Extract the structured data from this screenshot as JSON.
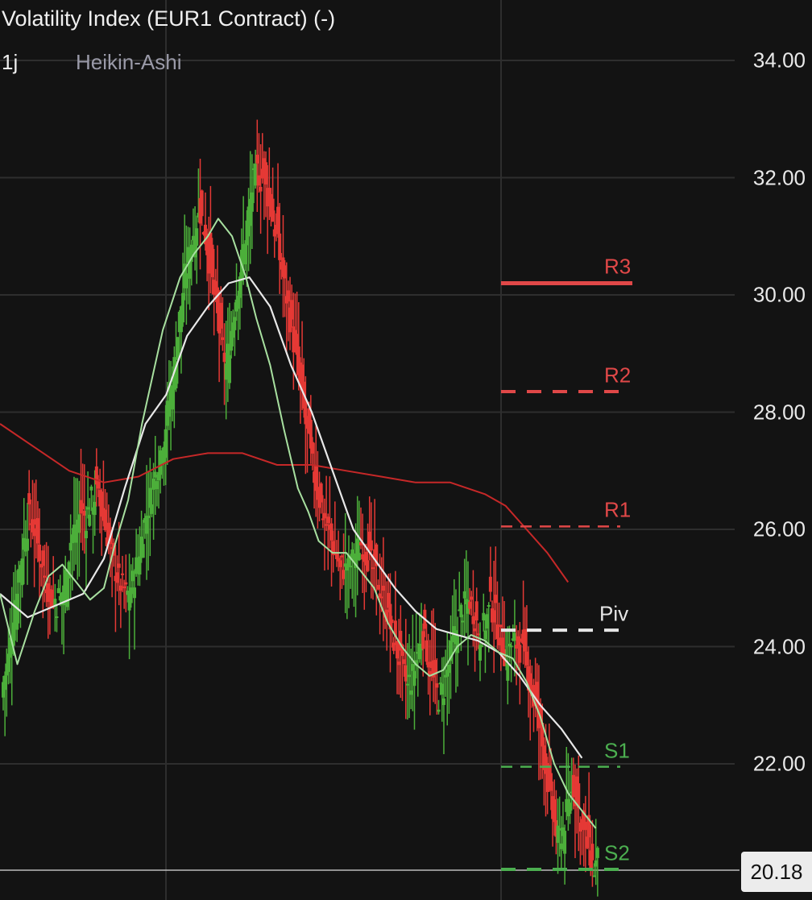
{
  "header": {
    "title": "Volatility Index (EUR1 Contract) (-)",
    "interval": "1j",
    "chart_type_label": "Heikin-Ashi"
  },
  "price": {
    "last": "20.18",
    "last_value": 20.18
  },
  "colors": {
    "background": "#131313",
    "grid": "#2e2e2e",
    "up": "#4caf3a",
    "down": "#e53935",
    "ma_long": "#c62828",
    "ma_mid": "#e8e8e8",
    "ma_short": "#a8e0a0",
    "resistance": "#e04848",
    "support": "#4caf50",
    "pivot": "#e6e6e6"
  },
  "y_axis": {
    "ticks": [
      {
        "value": 34,
        "label": "34.00"
      },
      {
        "value": 32,
        "label": "32.00"
      },
      {
        "value": 30,
        "label": "30.00"
      },
      {
        "value": 28,
        "label": "28.00"
      },
      {
        "value": 26,
        "label": "26.00"
      },
      {
        "value": 24,
        "label": "24.00"
      },
      {
        "value": 22,
        "label": "22.00"
      }
    ]
  },
  "pivots": [
    {
      "label": "R3",
      "value": 30.2,
      "kind": "resistance",
      "style": "solid"
    },
    {
      "label": "R2",
      "value": 28.35,
      "kind": "resistance",
      "style": "dashed"
    },
    {
      "label": "R1",
      "value": 26.05,
      "kind": "resistance",
      "style": "dashed-thin"
    },
    {
      "label": "Piv",
      "value": 24.28,
      "kind": "pivot",
      "style": "dashed"
    },
    {
      "label": "S1",
      "value": 21.95,
      "kind": "support",
      "style": "dashed-thin"
    },
    {
      "label": "S2",
      "value": 20.2,
      "kind": "support",
      "style": "dashed"
    }
  ],
  "chart_data": {
    "type": "line",
    "candles": "heikin-ashi",
    "ylim": [
      19.6,
      35.0
    ],
    "close_series": [
      23.4,
      23.8,
      24.6,
      25.3,
      25.8,
      26.2,
      26.0,
      25.6,
      25.2,
      24.9,
      24.7,
      24.8,
      25.2,
      25.8,
      26.1,
      26.3,
      26.2,
      26.5,
      26.6,
      26.3,
      25.9,
      25.5,
      25.2,
      25.0,
      24.9,
      25.1,
      25.5,
      26.0,
      26.4,
      26.8,
      27.2,
      27.6,
      28.2,
      28.8,
      29.6,
      30.3,
      30.8,
      31.2,
      31.4,
      31.0,
      30.4,
      29.8,
      29.2,
      28.8,
      29.4,
      30.0,
      30.6,
      31.2,
      31.8,
      32.1,
      32.0,
      31.7,
      31.3,
      30.8,
      30.3,
      29.8,
      29.2,
      28.6,
      28.0,
      27.4,
      26.9,
      26.5,
      26.2,
      25.9,
      25.6,
      25.4,
      25.3,
      25.4,
      25.6,
      25.8,
      25.6,
      25.4,
      25.2,
      24.9,
      24.6,
      24.2,
      23.9,
      23.6,
      23.3,
      23.5,
      23.9,
      24.2,
      23.8,
      23.4,
      23.1,
      23.3,
      23.7,
      24.2,
      24.5,
      24.7,
      24.8,
      24.5,
      24.2,
      24.4,
      24.7,
      24.5,
      24.1,
      23.8,
      24.0,
      24.1,
      23.9,
      23.6,
      23.2,
      22.8,
      22.3,
      21.7,
      21.1,
      20.7,
      20.9,
      21.3,
      21.6,
      21.2,
      20.8,
      20.5,
      20.18
    ],
    "ma_short": [
      [
        0,
        24.9
      ],
      [
        5,
        23.7
      ],
      [
        10,
        24.6
      ],
      [
        14,
        25.2
      ],
      [
        18,
        25.4
      ],
      [
        22,
        25.1
      ],
      [
        26,
        24.8
      ],
      [
        30,
        25.0
      ],
      [
        33,
        25.7
      ],
      [
        37,
        26.5
      ],
      [
        41,
        27.8
      ],
      [
        44,
        28.6
      ],
      [
        47,
        29.4
      ],
      [
        52,
        30.3
      ],
      [
        56,
        30.7
      ],
      [
        60,
        31.0
      ],
      [
        63,
        31.3
      ],
      [
        67,
        31.0
      ],
      [
        71,
        30.3
      ],
      [
        74,
        29.6
      ],
      [
        78,
        28.8
      ],
      [
        82,
        27.7
      ],
      [
        86,
        26.7
      ],
      [
        89,
        26.3
      ],
      [
        92,
        25.8
      ],
      [
        96,
        25.6
      ],
      [
        100,
        25.6
      ],
      [
        104,
        25.3
      ],
      [
        108,
        25.0
      ],
      [
        112,
        24.4
      ],
      [
        116,
        24.0
      ],
      [
        120,
        23.7
      ],
      [
        124,
        23.5
      ],
      [
        128,
        23.6
      ],
      [
        132,
        24.0
      ],
      [
        136,
        24.2
      ],
      [
        140,
        24.1
      ],
      [
        144,
        23.9
      ],
      [
        148,
        23.8
      ],
      [
        152,
        23.4
      ],
      [
        156,
        22.8
      ],
      [
        160,
        22.0
      ],
      [
        164,
        21.5
      ],
      [
        168,
        21.2
      ],
      [
        172,
        20.9
      ]
    ],
    "ma_mid": [
      [
        0,
        24.9
      ],
      [
        8,
        24.5
      ],
      [
        16,
        24.7
      ],
      [
        24,
        24.9
      ],
      [
        30,
        25.5
      ],
      [
        36,
        26.7
      ],
      [
        42,
        27.8
      ],
      [
        48,
        28.3
      ],
      [
        54,
        29.3
      ],
      [
        60,
        29.8
      ],
      [
        66,
        30.2
      ],
      [
        72,
        30.3
      ],
      [
        78,
        29.8
      ],
      [
        84,
        28.8
      ],
      [
        90,
        28.0
      ],
      [
        96,
        27.0
      ],
      [
        102,
        26.0
      ],
      [
        108,
        25.5
      ],
      [
        114,
        25.0
      ],
      [
        120,
        24.6
      ],
      [
        126,
        24.3
      ],
      [
        132,
        24.2
      ],
      [
        138,
        24.1
      ],
      [
        144,
        23.9
      ],
      [
        150,
        23.5
      ],
      [
        156,
        23.0
      ],
      [
        162,
        22.6
      ],
      [
        168,
        22.1
      ]
    ],
    "ma_long": [
      [
        0,
        27.8
      ],
      [
        10,
        27.4
      ],
      [
        20,
        27.0
      ],
      [
        30,
        26.8
      ],
      [
        40,
        26.9
      ],
      [
        50,
        27.2
      ],
      [
        60,
        27.3
      ],
      [
        70,
        27.3
      ],
      [
        80,
        27.1
      ],
      [
        90,
        27.1
      ],
      [
        100,
        27.0
      ],
      [
        110,
        26.9
      ],
      [
        120,
        26.8
      ],
      [
        130,
        26.8
      ],
      [
        140,
        26.6
      ],
      [
        146,
        26.4
      ],
      [
        152,
        26.0
      ],
      [
        158,
        25.6
      ],
      [
        164,
        25.1
      ]
    ]
  }
}
